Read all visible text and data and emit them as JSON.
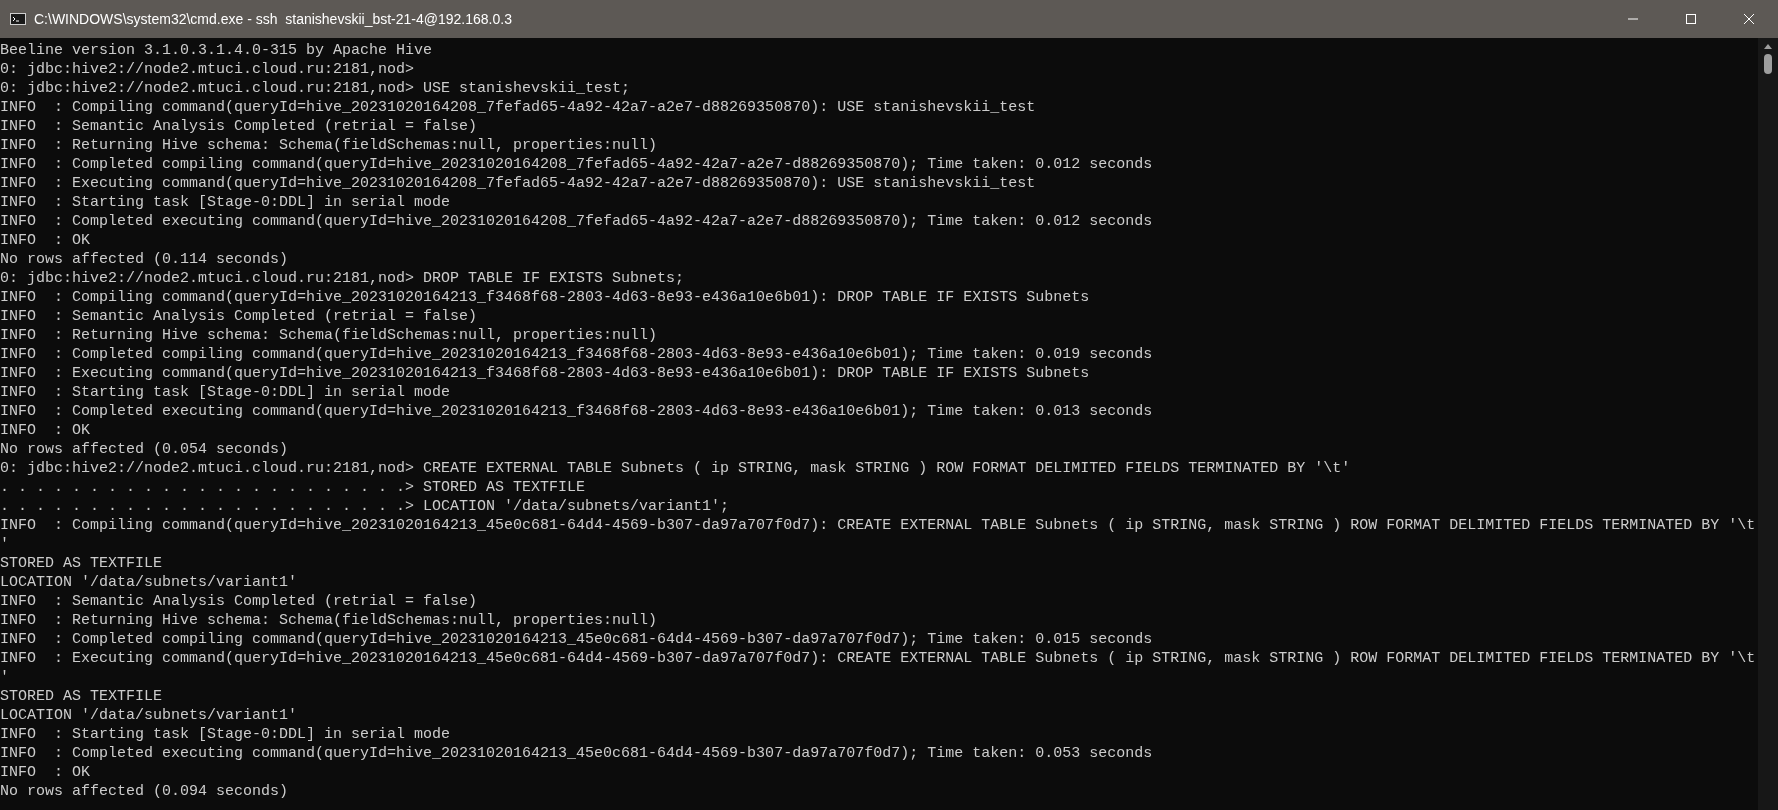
{
  "window": {
    "title": "C:\\WINDOWS\\system32\\cmd.exe - ssh  stanishevskii_bst-21-4@192.168.0.3"
  },
  "terminal": {
    "lines": [
      "Beeline version 3.1.0.3.1.4.0-315 by Apache Hive",
      "0: jdbc:hive2://node2.mtuci.cloud.ru:2181,nod>",
      "0: jdbc:hive2://node2.mtuci.cloud.ru:2181,nod> USE stanishevskii_test;",
      "INFO  : Compiling command(queryId=hive_20231020164208_7fefad65-4a92-42a7-a2e7-d88269350870): USE stanishevskii_test",
      "INFO  : Semantic Analysis Completed (retrial = false)",
      "INFO  : Returning Hive schema: Schema(fieldSchemas:null, properties:null)",
      "INFO  : Completed compiling command(queryId=hive_20231020164208_7fefad65-4a92-42a7-a2e7-d88269350870); Time taken: 0.012 seconds",
      "INFO  : Executing command(queryId=hive_20231020164208_7fefad65-4a92-42a7-a2e7-d88269350870): USE stanishevskii_test",
      "INFO  : Starting task [Stage-0:DDL] in serial mode",
      "INFO  : Completed executing command(queryId=hive_20231020164208_7fefad65-4a92-42a7-a2e7-d88269350870); Time taken: 0.012 seconds",
      "INFO  : OK",
      "No rows affected (0.114 seconds)",
      "0: jdbc:hive2://node2.mtuci.cloud.ru:2181,nod> DROP TABLE IF EXISTS Subnets;",
      "INFO  : Compiling command(queryId=hive_20231020164213_f3468f68-2803-4d63-8e93-e436a10e6b01): DROP TABLE IF EXISTS Subnets",
      "INFO  : Semantic Analysis Completed (retrial = false)",
      "INFO  : Returning Hive schema: Schema(fieldSchemas:null, properties:null)",
      "INFO  : Completed compiling command(queryId=hive_20231020164213_f3468f68-2803-4d63-8e93-e436a10e6b01); Time taken: 0.019 seconds",
      "INFO  : Executing command(queryId=hive_20231020164213_f3468f68-2803-4d63-8e93-e436a10e6b01): DROP TABLE IF EXISTS Subnets",
      "INFO  : Starting task [Stage-0:DDL] in serial mode",
      "INFO  : Completed executing command(queryId=hive_20231020164213_f3468f68-2803-4d63-8e93-e436a10e6b01); Time taken: 0.013 seconds",
      "INFO  : OK",
      "No rows affected (0.054 seconds)",
      "0: jdbc:hive2://node2.mtuci.cloud.ru:2181,nod> CREATE EXTERNAL TABLE Subnets ( ip STRING, mask STRING ) ROW FORMAT DELIMITED FIELDS TERMINATED BY '\\t'",
      ". . . . . . . . . . . . . . . . . . . . . . .> STORED AS TEXTFILE",
      ". . . . . . . . . . . . . . . . . . . . . . .> LOCATION '/data/subnets/variant1';",
      "INFO  : Compiling command(queryId=hive_20231020164213_45e0c681-64d4-4569-b307-da97a707f0d7): CREATE EXTERNAL TABLE Subnets ( ip STRING, mask STRING ) ROW FORMAT DELIMITED FIELDS TERMINATED BY '\\t",
      "'",
      "STORED AS TEXTFILE",
      "LOCATION '/data/subnets/variant1'",
      "INFO  : Semantic Analysis Completed (retrial = false)",
      "INFO  : Returning Hive schema: Schema(fieldSchemas:null, properties:null)",
      "INFO  : Completed compiling command(queryId=hive_20231020164213_45e0c681-64d4-4569-b307-da97a707f0d7); Time taken: 0.015 seconds",
      "INFO  : Executing command(queryId=hive_20231020164213_45e0c681-64d4-4569-b307-da97a707f0d7): CREATE EXTERNAL TABLE Subnets ( ip STRING, mask STRING ) ROW FORMAT DELIMITED FIELDS TERMINATED BY '\\t",
      "'",
      "STORED AS TEXTFILE",
      "LOCATION '/data/subnets/variant1'",
      "INFO  : Starting task [Stage-0:DDL] in serial mode",
      "INFO  : Completed executing command(queryId=hive_20231020164213_45e0c681-64d4-4569-b307-da97a707f0d7); Time taken: 0.053 seconds",
      "INFO  : OK",
      "No rows affected (0.094 seconds)"
    ]
  }
}
